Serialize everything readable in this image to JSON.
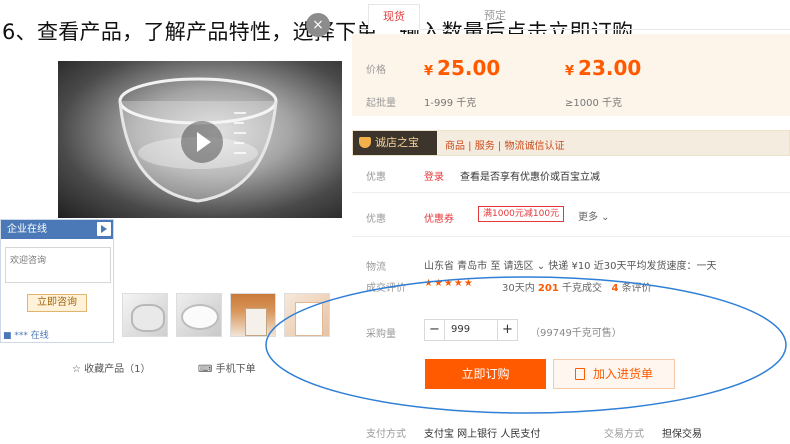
{
  "caption": "6、查看产品，了解产品特性，选择下单，输入数量后点击立即订购",
  "tabs": [
    {
      "label": "现货"
    },
    {
      "label": "预定"
    }
  ],
  "price_box": {
    "price_label": "价格",
    "price1": "25.00",
    "price2": "23.00",
    "currency": "¥",
    "moq_label": "起批量",
    "range1": "1-999 千克",
    "range2": "≥1000 千克"
  },
  "shop": {
    "badge": "诚店之宝",
    "text": "商品 | 服务 | 物流诚信认证"
  },
  "offer": {
    "label": "优惠",
    "tag": "登录",
    "text": "查看是否享有优惠价或百宝立减"
  },
  "coupon": {
    "label": "优惠",
    "tag": "优惠券",
    "coupon_text": "满1000元减100元",
    "more": "更多 ⌄"
  },
  "delivery": {
    "label": "物流",
    "text": "山东省 青岛市  至  请选区   ⌄   快递 ¥10   近30天平均发货速度：一天"
  },
  "eval": {
    "label": "成交评价",
    "stars": "★★★★★",
    "text_a": "30天内",
    "count": "201",
    "text_b": "千克成交",
    "reviews": "4",
    "text_c": "条评价"
  },
  "purchase": {
    "label": "采购量",
    "minus": "−",
    "plus": "+",
    "quantity": "999",
    "stock": "（99749千克可售）"
  },
  "actions": {
    "buy": "立即订购",
    "cart": "加入进货单"
  },
  "footer": {
    "pay_label": "支付方式",
    "pay_value": "支付宝  网上银行  人民支付",
    "trade_label": "交易方式",
    "trade_value": "担保交易"
  },
  "left": {
    "favorite": "☆  收藏产品（1）",
    "mobile": "⌨  手机下单",
    "close_icon": "×"
  },
  "chat": {
    "title": "企业在线",
    "placeholder": "欢迎咨询",
    "button": "立即咨询",
    "footer": "■ *** 在线"
  },
  "annotation_color": "#2f7fd6"
}
